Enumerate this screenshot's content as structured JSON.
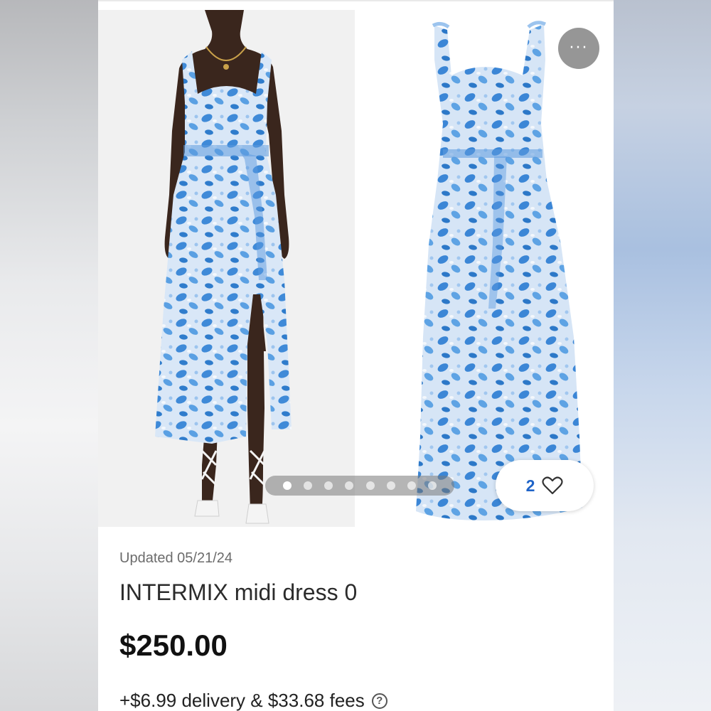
{
  "listing": {
    "updated": "Updated 05/21/24",
    "title": "INTERMIX midi dress 0",
    "price": "$250.00",
    "fees": "+$6.99 delivery & $33.68 fees"
  },
  "gallery": {
    "image_count": 8,
    "active_index": 0,
    "like_count": "2",
    "more_label": "···"
  },
  "icons": {
    "more": "more-horizontal-icon",
    "like": "heart-outline-icon",
    "help": "question-circle-icon"
  },
  "colors": {
    "accent": "#1f64c8",
    "dress_print": "#3b86d6",
    "dress_base": "#d7e6f7"
  }
}
